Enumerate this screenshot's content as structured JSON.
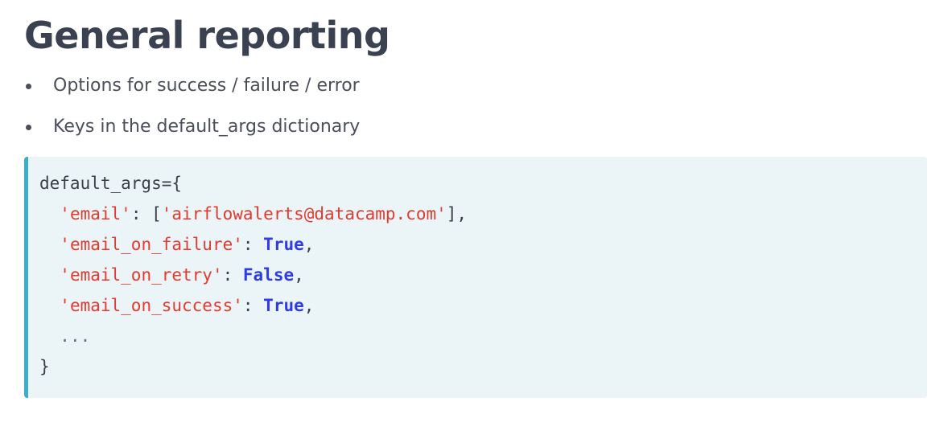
{
  "slide": {
    "title": "General reporting",
    "bullets": [
      "Options for success / failure / error",
      "Keys in the default_args dictionary"
    ]
  },
  "code": {
    "line1": "default_args={",
    "email_key": "'email'",
    "email_value": "'airflowalerts@datacamp.com'",
    "failure_key": "'email_on_failure'",
    "failure_value": "True",
    "retry_key": "'email_on_retry'",
    "retry_value": "False",
    "success_key": "'email_on_success'",
    "success_value": "True",
    "ellipsis": "...",
    "closing": "}"
  },
  "colors": {
    "accent_bar": "#3aaecb",
    "code_background": "#ebf4f7",
    "string": "#e23a2e",
    "keyword": "#2f3ce6"
  }
}
